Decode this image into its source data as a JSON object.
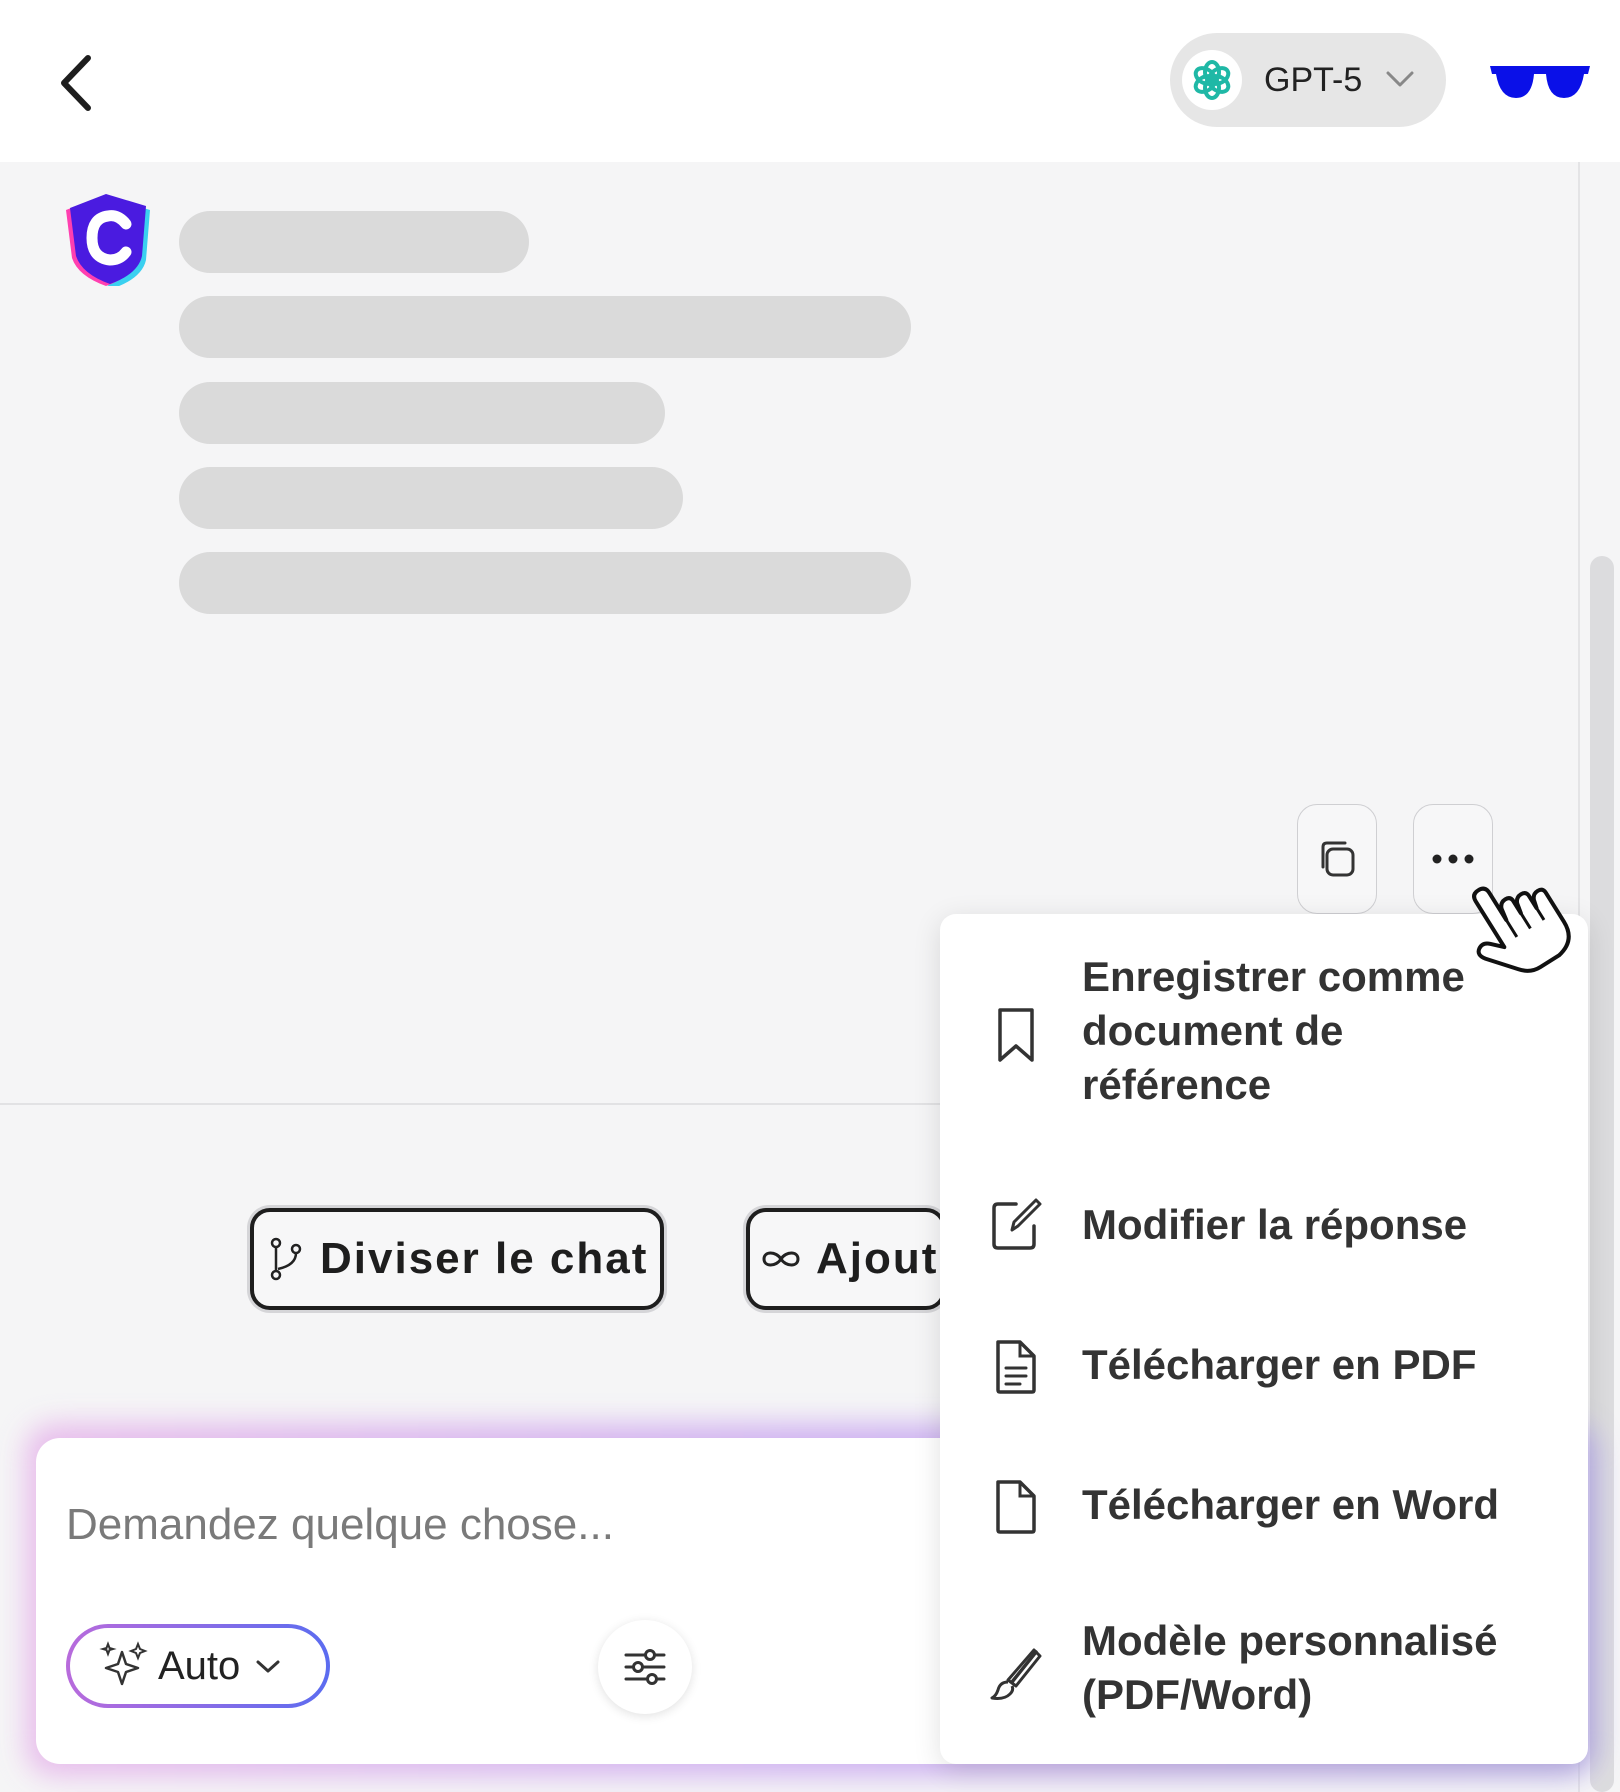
{
  "header": {
    "model": {
      "name": "GPT-5",
      "icon": "openai-logo-icon",
      "chevron": "chevron-down-icon"
    }
  },
  "skeleton_lines": 5,
  "message_actions": {
    "copy_icon": "copy-icon",
    "more_icon": "more-horizontal-icon"
  },
  "actions": {
    "split": {
      "icon": "branch-icon",
      "label": "Diviser le chat"
    },
    "add": {
      "icon": "infinity-icon",
      "label": "Ajoute"
    }
  },
  "composer": {
    "placeholder": "Demandez quelque chose...",
    "mode": {
      "icon": "sparkles-icon",
      "label": "Auto"
    },
    "settings_icon": "sliders-icon"
  },
  "menu": {
    "items": [
      {
        "icon": "bookmark-icon",
        "lines": [
          "Enregistrer comme",
          "document de",
          "référence"
        ]
      },
      {
        "icon": "edit-icon",
        "lines": [
          "Modifier la réponse"
        ]
      },
      {
        "icon": "file-text-icon",
        "lines": [
          "Télécharger en PDF"
        ]
      },
      {
        "icon": "file-icon",
        "lines": [
          "Télécharger en Word"
        ]
      },
      {
        "icon": "brush-icon",
        "lines": [
          "Modèle personnalisé",
          "(PDF/Word)"
        ]
      }
    ]
  }
}
